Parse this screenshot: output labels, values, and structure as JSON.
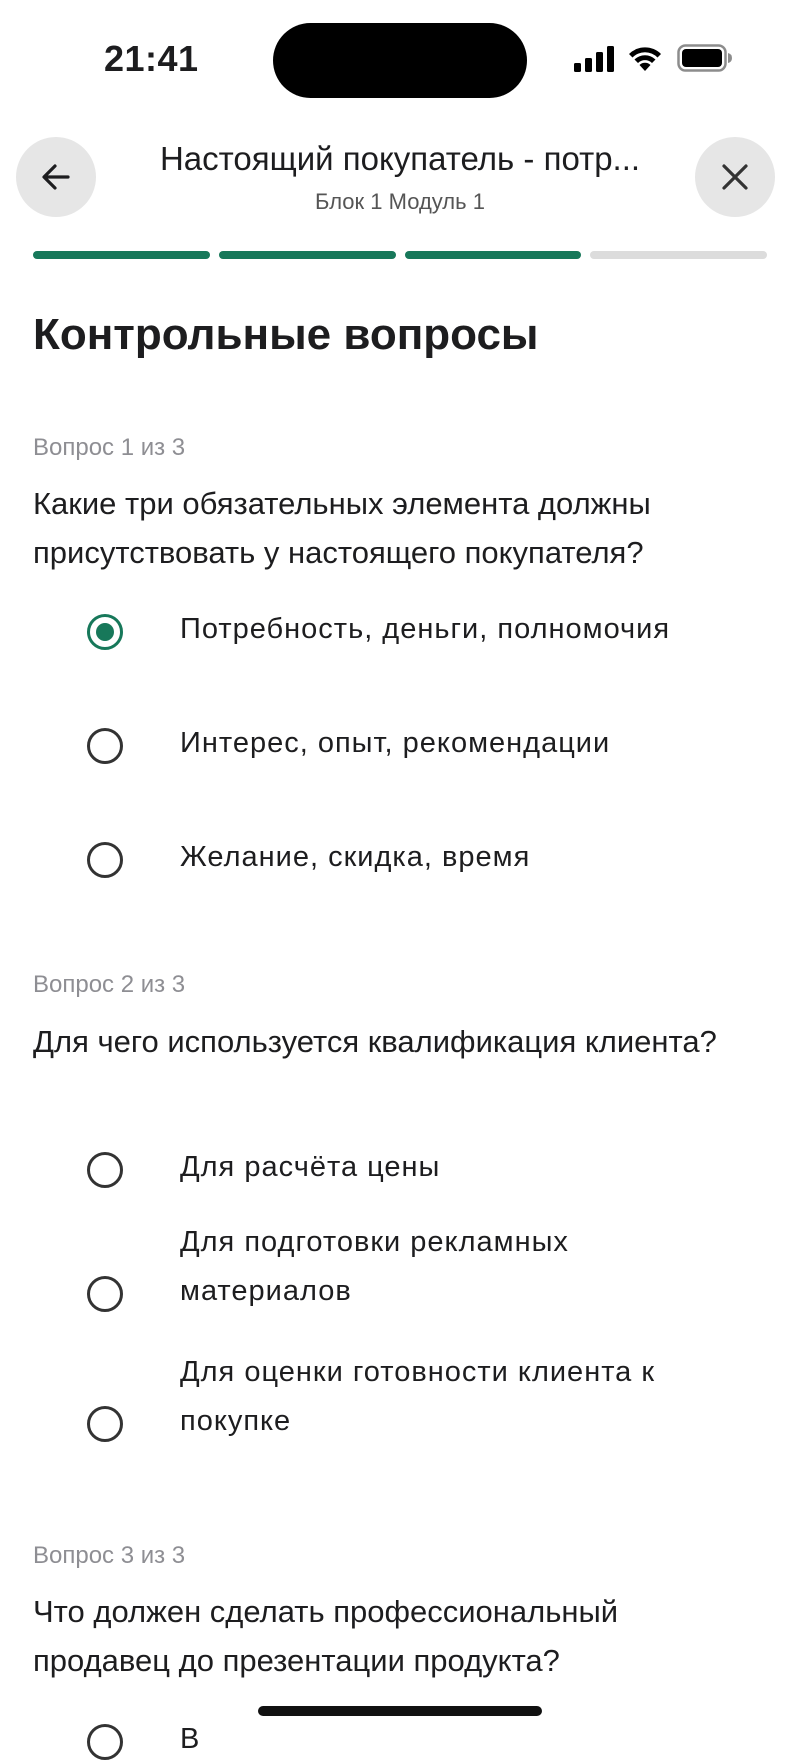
{
  "status_bar": {
    "time": "21:41"
  },
  "header": {
    "title": "Настоящий покупатель - потр...",
    "subtitle": "Блок 1 Модуль 1",
    "back_icon": "arrow-left-icon",
    "close_icon": "close-icon"
  },
  "progress": {
    "total_steps": 4,
    "completed_steps": 3,
    "accent_color": "#17785a"
  },
  "page_title": "Контрольные вопросы",
  "questions": [
    {
      "counter": "Вопрос 1 из 3",
      "text": "Какие три обязательных элемента должны присутствовать у настоящего покупателя?",
      "options": [
        {
          "label": "Потребность, деньги, полномочия",
          "selected": true
        },
        {
          "label": "Интерес, опыт, рекомендации",
          "selected": false
        },
        {
          "label": "Желание, скидка, время",
          "selected": false
        }
      ]
    },
    {
      "counter": "Вопрос 2 из 3",
      "text": "Для чего используется квалификация клиента?",
      "options": [
        {
          "label": "Для расчёта цены",
          "selected": false
        },
        {
          "label": "Для подготовки рекламных материалов",
          "selected": false
        },
        {
          "label": "Для оценки готовности клиента к покупке",
          "selected": false
        }
      ]
    },
    {
      "counter": "Вопрос 3 из 3",
      "text": "Что должен сделать профессиональный продавец до презентации продукта?",
      "options": [
        {
          "label": "В",
          "selected": false
        }
      ]
    }
  ]
}
